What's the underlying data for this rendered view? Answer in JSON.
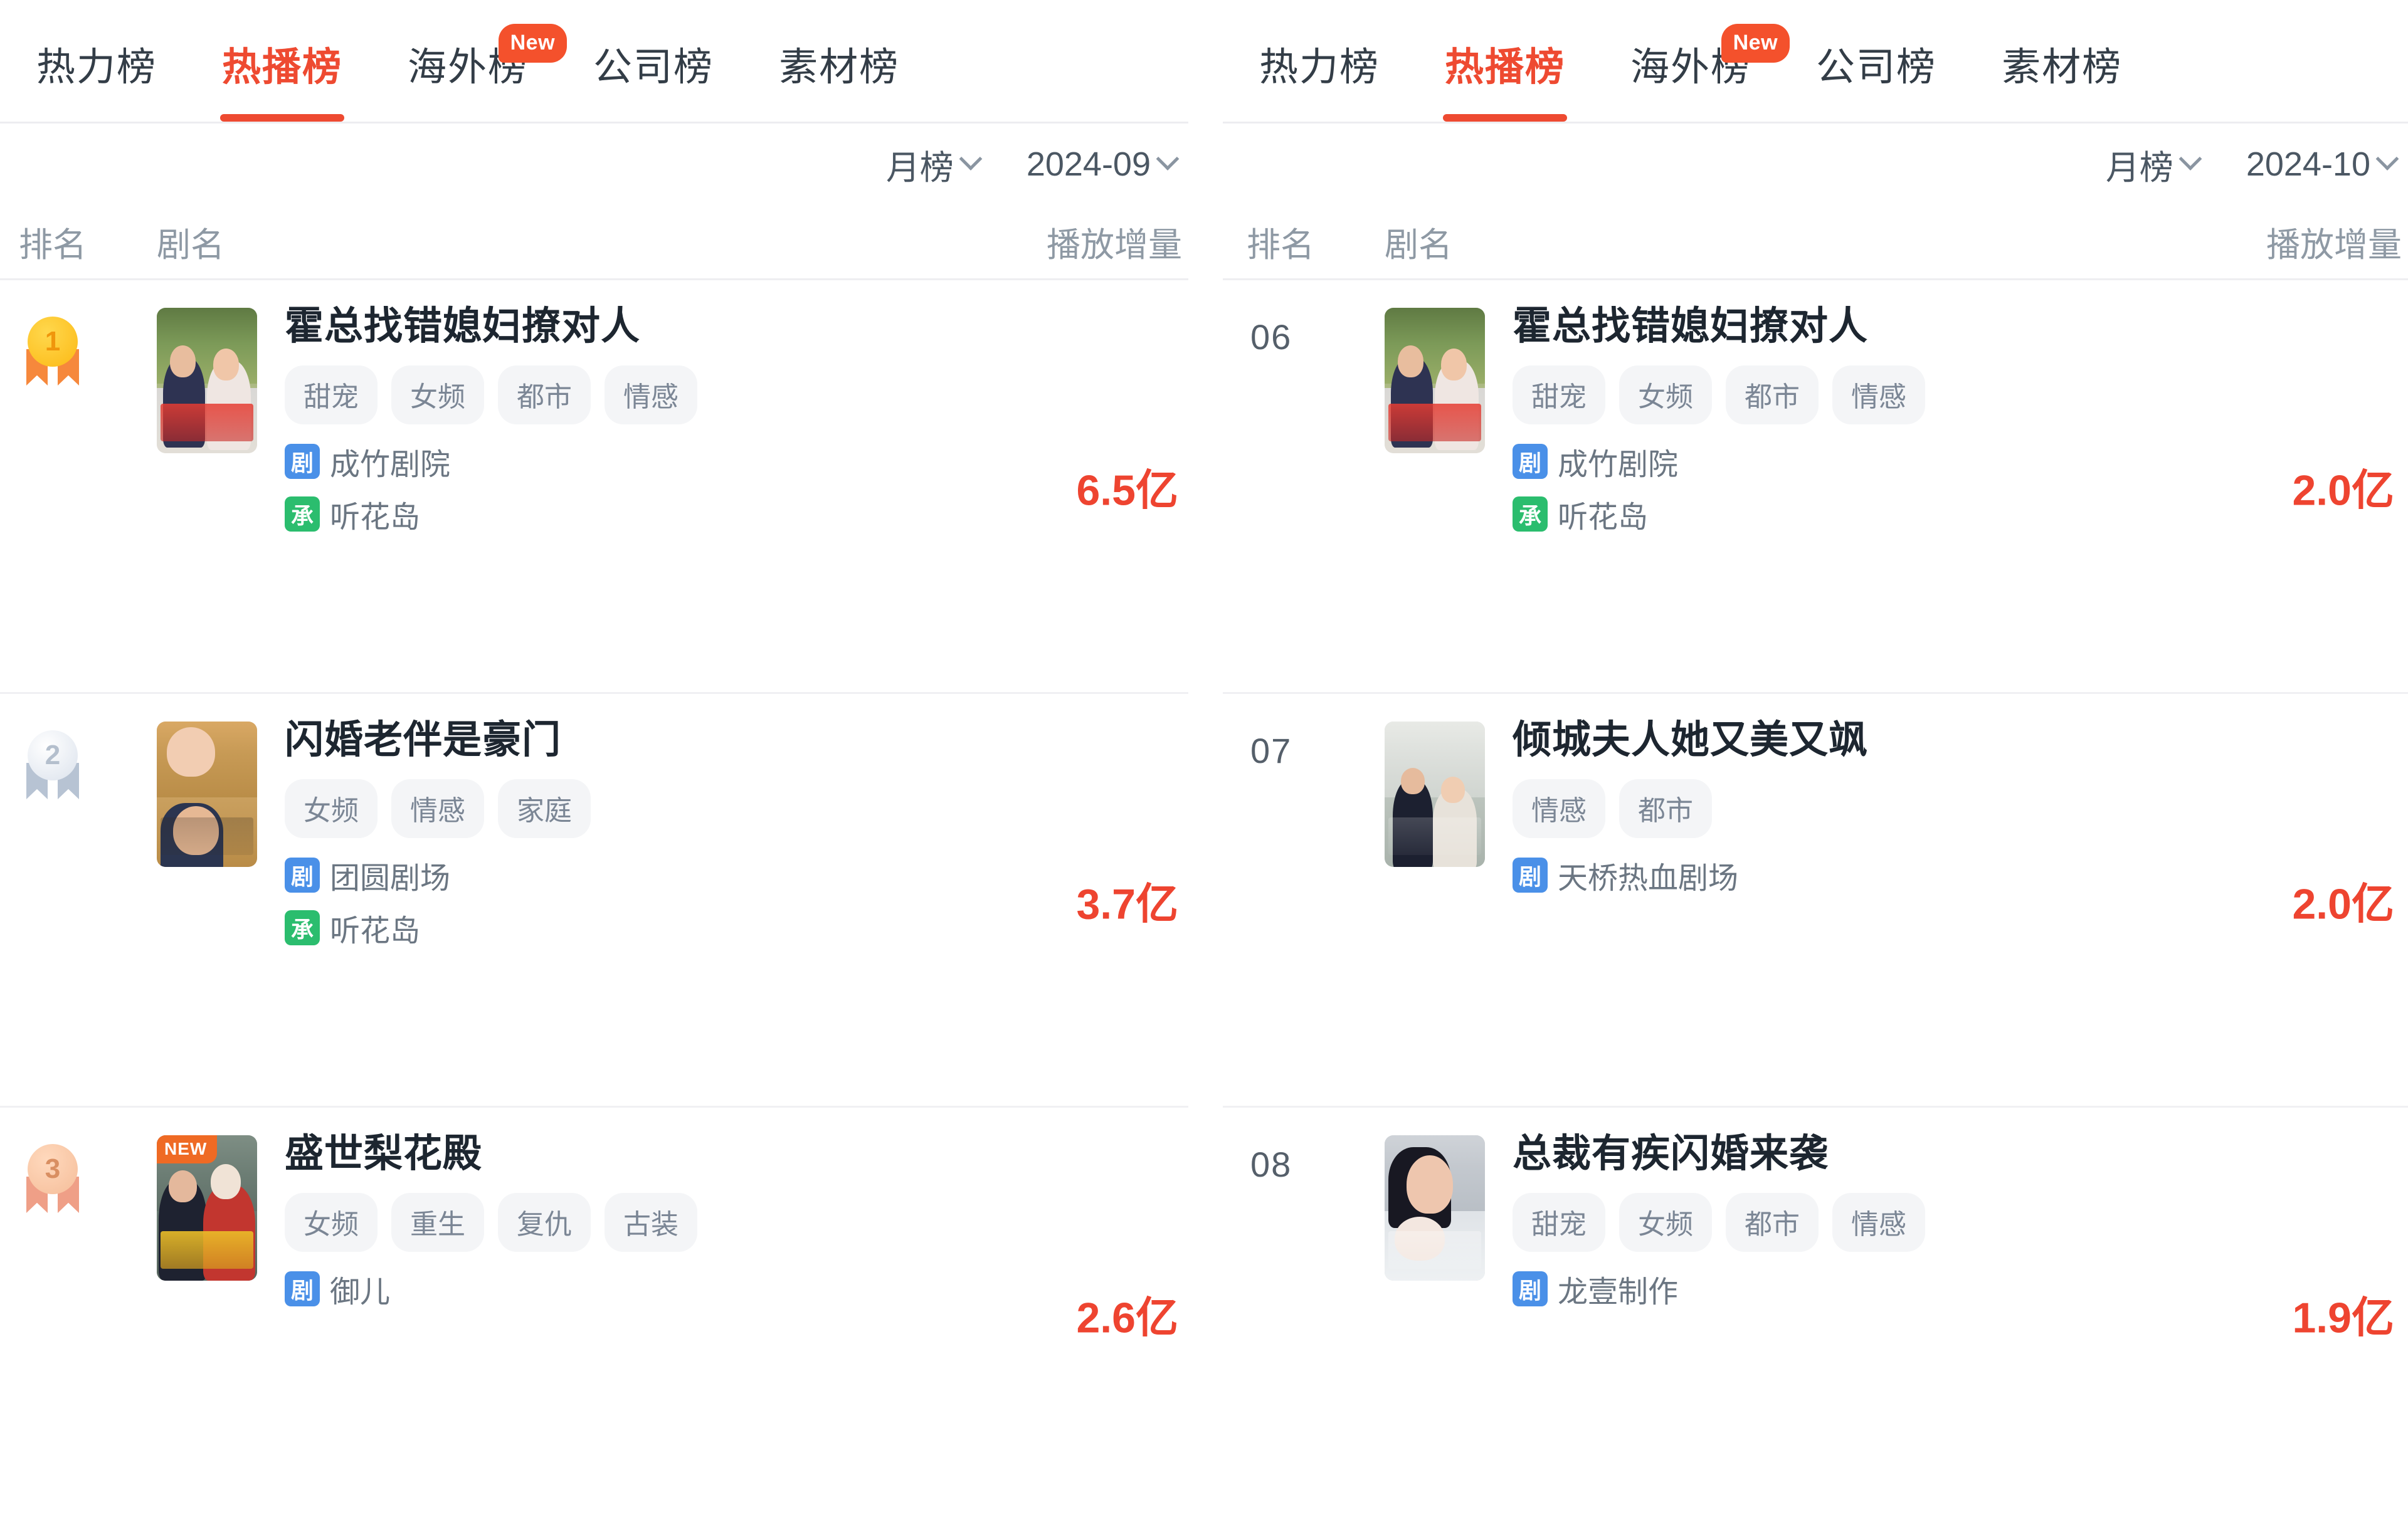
{
  "panels": [
    {
      "id": "left-panel",
      "tabs": [
        {
          "label": "热力榜",
          "active": false,
          "badge": null
        },
        {
          "label": "热播榜",
          "active": true,
          "badge": null
        },
        {
          "label": "海外榜",
          "active": false,
          "badge": "New"
        },
        {
          "label": "公司榜",
          "active": false,
          "badge": null
        },
        {
          "label": "素材榜",
          "active": false,
          "badge": null
        }
      ],
      "filters": {
        "period": "月榜",
        "date": "2024-09"
      },
      "columns": {
        "rank": "排名",
        "name": "剧名",
        "plays": "播放增量"
      },
      "rows": [
        {
          "rank": "1",
          "rank_style": "medal-gold",
          "title": "霍总找错媳妇撩对人",
          "tags": [
            "甜宠",
            "女频",
            "都市",
            "情感"
          ],
          "studios": [
            {
              "badge": "剧",
              "badge_color": "#4a90e8",
              "name": "成竹剧院"
            },
            {
              "badge": "承",
              "badge_color": "#2bbd6e",
              "name": "听花岛"
            }
          ],
          "plays": "6.5亿",
          "poster_new": false
        },
        {
          "rank": "2",
          "rank_style": "medal-silver",
          "title": "闪婚老伴是豪门",
          "tags": [
            "女频",
            "情感",
            "家庭"
          ],
          "studios": [
            {
              "badge": "剧",
              "badge_color": "#4a90e8",
              "name": "团圆剧场"
            },
            {
              "badge": "承",
              "badge_color": "#2bbd6e",
              "name": "听花岛"
            }
          ],
          "plays": "3.7亿",
          "poster_new": false
        },
        {
          "rank": "3",
          "rank_style": "medal-bronze",
          "title": "盛世梨花殿",
          "tags": [
            "女频",
            "重生",
            "复仇",
            "古装"
          ],
          "studios": [
            {
              "badge": "剧",
              "badge_color": "#4a90e8",
              "name": "御儿"
            }
          ],
          "plays": "2.6亿",
          "poster_new": true,
          "poster_new_label": "NEW"
        }
      ]
    },
    {
      "id": "right-panel",
      "tabs": [
        {
          "label": "热力榜",
          "active": false,
          "badge": null
        },
        {
          "label": "热播榜",
          "active": true,
          "badge": null
        },
        {
          "label": "海外榜",
          "active": false,
          "badge": "New"
        },
        {
          "label": "公司榜",
          "active": false,
          "badge": null
        },
        {
          "label": "素材榜",
          "active": false,
          "badge": null
        }
      ],
      "filters": {
        "period": "月榜",
        "date": "2024-10"
      },
      "columns": {
        "rank": "排名",
        "name": "剧名",
        "plays": "播放增量"
      },
      "rows": [
        {
          "rank": "06",
          "rank_style": "number",
          "title": "霍总找错媳妇撩对人",
          "tags": [
            "甜宠",
            "女频",
            "都市",
            "情感"
          ],
          "studios": [
            {
              "badge": "剧",
              "badge_color": "#4a90e8",
              "name": "成竹剧院"
            },
            {
              "badge": "承",
              "badge_color": "#2bbd6e",
              "name": "听花岛"
            }
          ],
          "plays": "2.0亿",
          "poster_new": false
        },
        {
          "rank": "07",
          "rank_style": "number",
          "title": "倾城夫人她又美又飒",
          "tags": [
            "情感",
            "都市"
          ],
          "studios": [
            {
              "badge": "剧",
              "badge_color": "#4a90e8",
              "name": "天桥热血剧场"
            }
          ],
          "plays": "2.0亿",
          "poster_new": false
        },
        {
          "rank": "08",
          "rank_style": "number",
          "title": "总裁有疾闪婚来袭",
          "tags": [
            "甜宠",
            "女频",
            "都市",
            "情感"
          ],
          "studios": [
            {
              "badge": "剧",
              "badge_color": "#4a90e8",
              "name": "龙壹制作"
            }
          ],
          "plays": "1.9亿",
          "poster_new": false
        }
      ]
    }
  ],
  "colors": {
    "accent": "#ee4a31",
    "plays_value": "#ee4430",
    "tag_bg": "#f4f5f7",
    "tag_text": "#7b8695",
    "studio_blue": "#4a90e8",
    "studio_green": "#2bbd6e",
    "new_badge": "#f4512c",
    "poster_new": "#ef6a24"
  }
}
